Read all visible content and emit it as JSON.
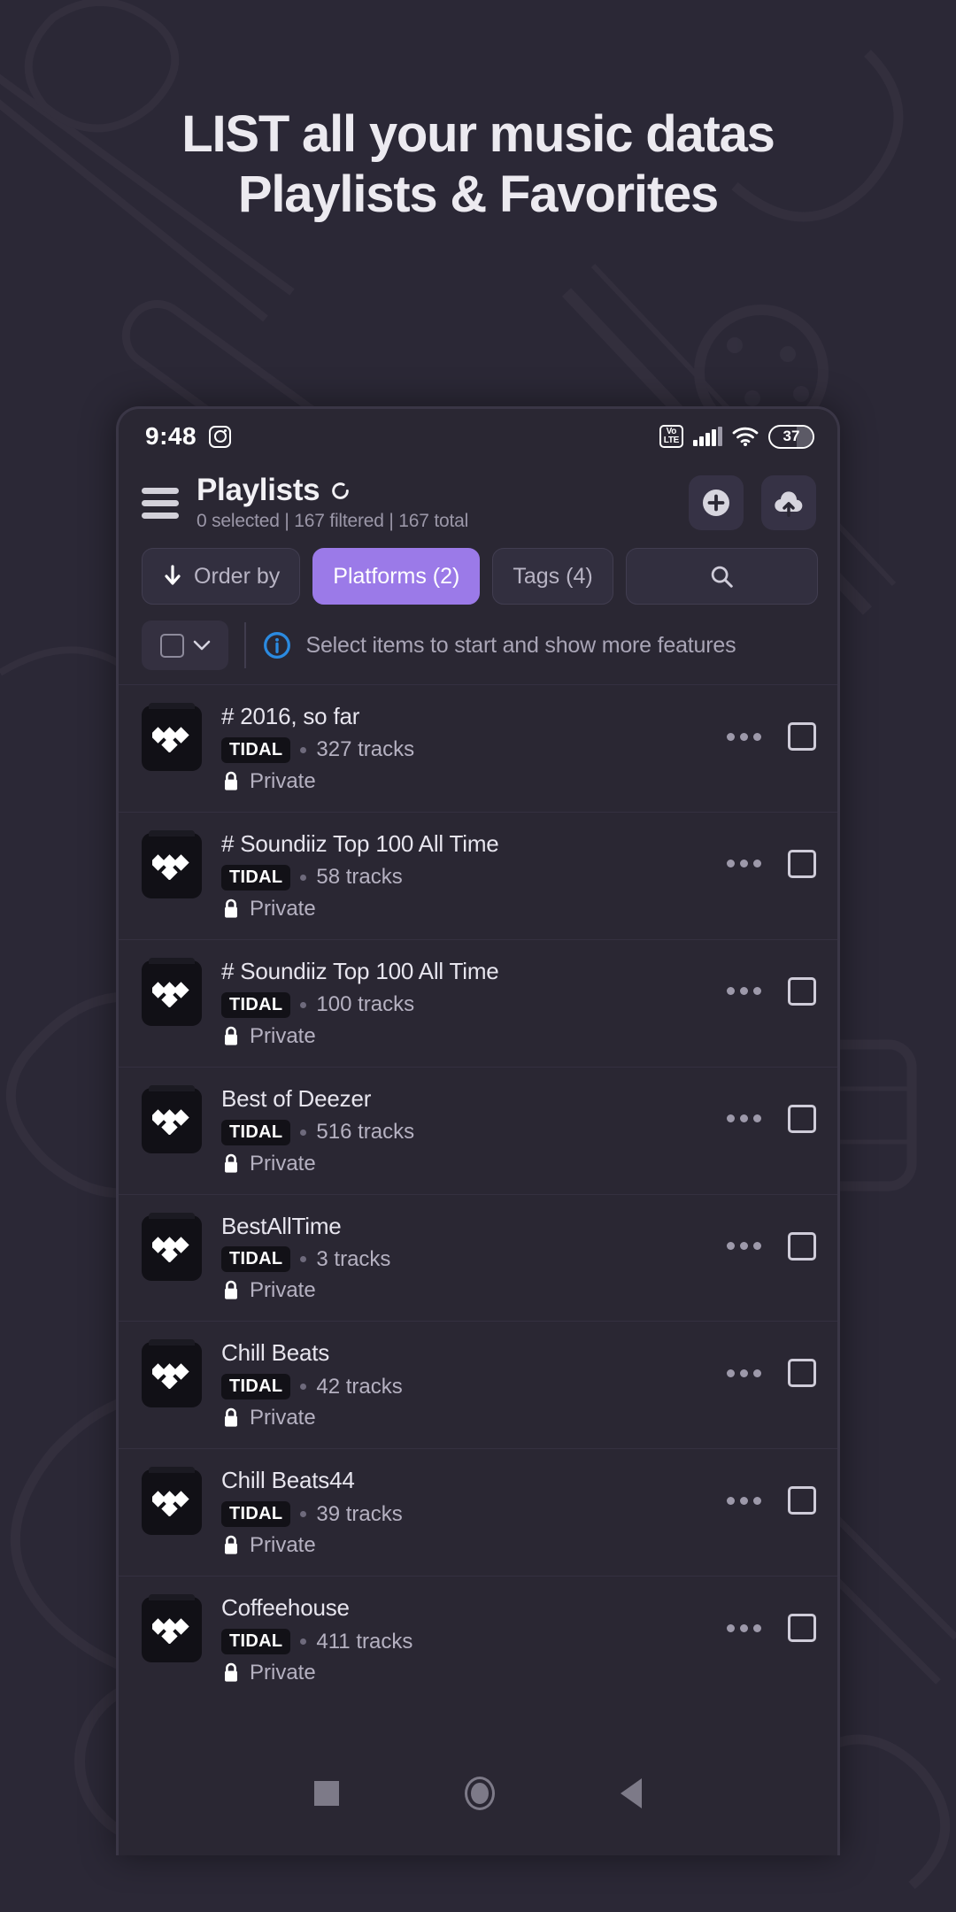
{
  "headline": {
    "line1": "LIST all your music datas",
    "line2": "Playlists & Favorites"
  },
  "colors": {
    "page_bg": "#2b2836",
    "accent_purple": "#9b7ae8",
    "info_blue": "#2b8ae0",
    "text_primary": "#e7e5ee",
    "text_muted": "#a9a5b6"
  },
  "statusbar": {
    "time": "9:48",
    "app_icon": "instagram-icon",
    "volte_top": "Vo",
    "volte_bottom": "LTE",
    "signal_icon": "signal-bars-icon",
    "wifi_icon": "wifi-icon",
    "battery_level": "37"
  },
  "appheader": {
    "menu_icon": "hamburger-menu-icon",
    "title": "Playlists",
    "refresh_icon": "refresh-icon",
    "subtitle": "0 selected | 167 filtered | 167 total",
    "add_button_icon": "plus-circle-icon",
    "upload_button_icon": "cloud-upload-icon"
  },
  "filters": {
    "order_by": {
      "label": "Order by",
      "icon": "arrow-down-icon",
      "active": false
    },
    "platforms": {
      "label": "Platforms (2)",
      "active": true
    },
    "tags": {
      "label": "Tags (4)",
      "active": false
    },
    "search": {
      "icon": "search-icon",
      "placeholder": ""
    }
  },
  "selectbar": {
    "checkbox_icon": "checkbox-unchecked-icon",
    "chevron_icon": "chevron-down-icon",
    "info_icon": "info-circle-icon",
    "message": "Select items to start and show more features"
  },
  "list": {
    "platform_badge": "TIDAL",
    "privacy_label": "Private",
    "items": [
      {
        "name": "# 2016, so far",
        "platform": "TIDAL",
        "tracks": "327 tracks",
        "privacy": "Private"
      },
      {
        "name": "# Soundiiz Top 100 All Time",
        "platform": "TIDAL",
        "tracks": "58 tracks",
        "privacy": "Private"
      },
      {
        "name": "# Soundiiz Top 100 All Time",
        "platform": "TIDAL",
        "tracks": "100 tracks",
        "privacy": "Private"
      },
      {
        "name": "Best of Deezer",
        "platform": "TIDAL",
        "tracks": "516 tracks",
        "privacy": "Private"
      },
      {
        "name": "BestAllTime",
        "platform": "TIDAL",
        "tracks": "3 tracks",
        "privacy": "Private"
      },
      {
        "name": "Chill Beats",
        "platform": "TIDAL",
        "tracks": "42 tracks",
        "privacy": "Private"
      },
      {
        "name": "Chill Beats44",
        "platform": "TIDAL",
        "tracks": "39 tracks",
        "privacy": "Private"
      },
      {
        "name": "Coffeehouse",
        "platform": "TIDAL",
        "tracks": "411 tracks",
        "privacy": "Private"
      }
    ]
  },
  "navbar": {
    "recents_icon": "square-recents-icon",
    "home_icon": "circle-home-icon",
    "back_icon": "triangle-back-icon"
  }
}
